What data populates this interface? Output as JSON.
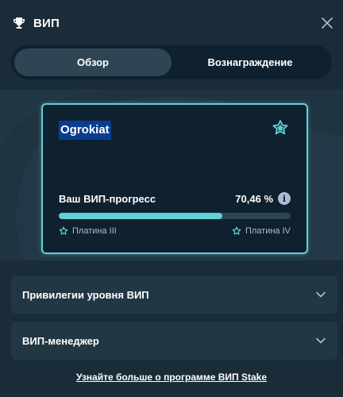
{
  "header": {
    "title": "ВИП",
    "trophy_icon": "trophy-icon",
    "close_icon": "close-icon"
  },
  "tabs": [
    {
      "label": "Обзор",
      "active": true
    },
    {
      "label": "Вознаграждение",
      "active": false
    }
  ],
  "card": {
    "username": "Ogrokiat",
    "rank_icon": "star-badge-icon",
    "progress_label": "Ваш ВИП-прогресс",
    "progress_value": "70,46 %",
    "progress_fraction": 0.7046,
    "info_icon": "info-icon",
    "current_level": "Платина III",
    "next_level": "Платина IV"
  },
  "accordions": [
    {
      "label": "Привилегии уровня ВИП"
    },
    {
      "label": "ВИП-менеджер"
    }
  ],
  "footer": {
    "link": "Узнайте больше о программе ВИП Stake"
  },
  "colors": {
    "background": "#1a2c38",
    "panel": "#213743",
    "card": "#0f212e",
    "accent": "#60d0d9",
    "muted": "#b1bad3"
  }
}
